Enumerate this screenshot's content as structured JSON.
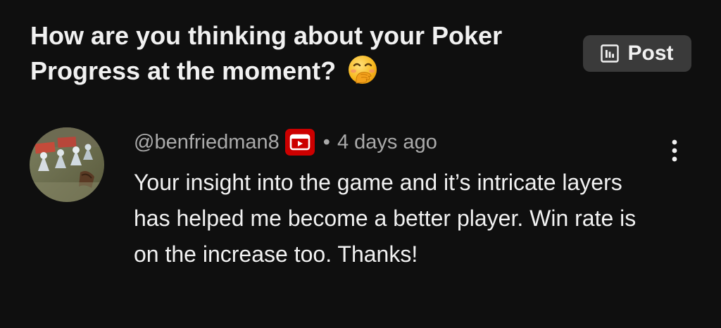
{
  "post": {
    "title_line1": "How are you thinking about your Poker",
    "title_line2": "Progress at the moment?",
    "emoji_icon": "face-with-hand-over-mouth-emoji",
    "badge_icon": "poll-icon",
    "badge_label": "Post"
  },
  "comment": {
    "avatar_icon": "avatar",
    "author": "@benfriedman8",
    "member_badge_icon": "youtube-member-badge-icon",
    "separator": "•",
    "time": "4 days ago",
    "text": "Your insight into the game and it’s intricate layers has helped me become a better player. Win rate is on the increase too. Thanks!",
    "menu_icon": "more-vertical-icon"
  },
  "colors": {
    "background": "#0f0f0f",
    "primary_text": "#f1f1f1",
    "secondary_text": "#aaaaaa",
    "badge_bg": "#3a3a3a",
    "brand_red": "#cc0000"
  }
}
